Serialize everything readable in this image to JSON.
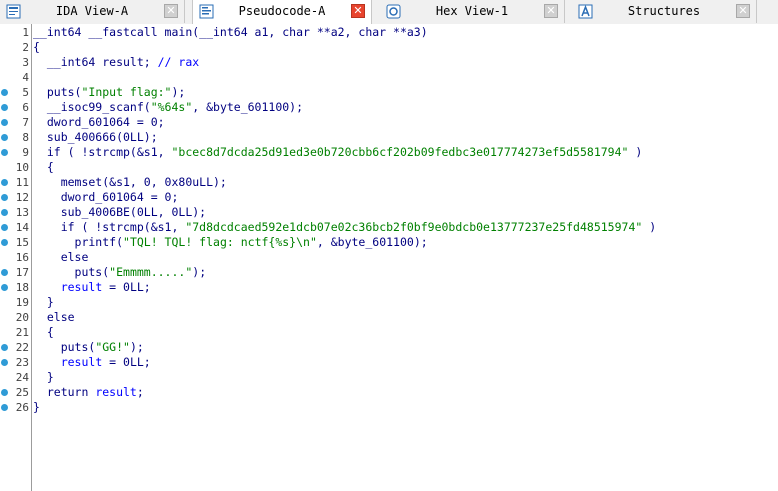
{
  "tabs": [
    {
      "label": "IDA View-A",
      "icon": "ida-view-icon",
      "active": false
    },
    {
      "label": "Pseudocode-A",
      "icon": "pseudocode-icon",
      "active": true
    },
    {
      "label": "Hex View-1",
      "icon": "hex-view-icon",
      "active": false
    },
    {
      "label": "Structures",
      "icon": "structures-icon",
      "active": false
    }
  ],
  "colors": {
    "keyword": "#000080",
    "comment": "#0000ff",
    "string": "#008000",
    "variable": "#0000ff",
    "breakpoint_dot": "#2f9bd6",
    "close_active": "#e8442e"
  },
  "code": [
    {
      "n": "1",
      "dot": false,
      "text": "__int64 __fastcall main(__int64 a1, char **a2, char **a3)",
      "tokens": [
        {
          "t": "__int64 __fastcall main(__int64 a1, char **a2, char **a3)",
          "c": "kw"
        }
      ]
    },
    {
      "n": "2",
      "dot": false,
      "text": "{",
      "tokens": [
        {
          "t": "{",
          "c": "kw"
        }
      ]
    },
    {
      "n": "3",
      "dot": false,
      "text": "  __int64 result; // rax",
      "tokens": [
        {
          "t": "  __int64 result; ",
          "c": "kw"
        },
        {
          "t": "// rax",
          "c": "cm"
        }
      ]
    },
    {
      "n": "4",
      "dot": false,
      "text": "",
      "tokens": []
    },
    {
      "n": "5",
      "dot": true,
      "text": "  puts(\"Input flag:\");",
      "tokens": [
        {
          "t": "  puts(",
          "c": "kw"
        },
        {
          "t": "\"Input flag:\"",
          "c": "str"
        },
        {
          "t": ");",
          "c": "kw"
        }
      ]
    },
    {
      "n": "6",
      "dot": true,
      "text": "  __isoc99_scanf(\"%64s\", &byte_601100);",
      "tokens": [
        {
          "t": "  __isoc99_scanf(",
          "c": "kw"
        },
        {
          "t": "\"%64s\"",
          "c": "str"
        },
        {
          "t": ", &byte_601100);",
          "c": "kw"
        }
      ]
    },
    {
      "n": "7",
      "dot": true,
      "text": "  dword_601064 = 0;",
      "tokens": [
        {
          "t": "  dword_601064 = 0;",
          "c": "kw"
        }
      ]
    },
    {
      "n": "8",
      "dot": true,
      "text": "  sub_400666(0LL);",
      "tokens": [
        {
          "t": "  sub_400666(0LL);",
          "c": "kw"
        }
      ]
    },
    {
      "n": "9",
      "dot": true,
      "text": "  if ( !strcmp(&s1, \"bcec8d7dcda25d91ed3e0b720cbb6cf202b09fedbc3e017774273ef5d5581794\") )",
      "tokens": [
        {
          "t": "  if ( !strcmp(&s1, ",
          "c": "kw"
        },
        {
          "t": "\"bcec8d7dcda25d91ed3e0b720cbb6cf202b09fedbc3e017774273ef5d5581794\"",
          "c": "str"
        },
        {
          "t": " )",
          "c": "kw"
        }
      ]
    },
    {
      "n": "10",
      "dot": false,
      "text": "  {",
      "tokens": [
        {
          "t": "  {",
          "c": "kw"
        }
      ]
    },
    {
      "n": "11",
      "dot": true,
      "text": "    memset(&s1, 0, 0x80uLL);",
      "tokens": [
        {
          "t": "    memset(&s1, 0, 0x80uLL);",
          "c": "kw"
        }
      ]
    },
    {
      "n": "12",
      "dot": true,
      "text": "    dword_601064 = 0;",
      "tokens": [
        {
          "t": "    dword_601064 = 0;",
          "c": "kw"
        }
      ]
    },
    {
      "n": "13",
      "dot": true,
      "text": "    sub_4006BE(0LL, 0LL);",
      "tokens": [
        {
          "t": "    sub_4006BE(0LL, 0LL);",
          "c": "kw"
        }
      ]
    },
    {
      "n": "14",
      "dot": true,
      "text": "    if ( !strcmp(&s1, \"7d8dcdcaed592e1dcb07e02c36bcb2f0bf9e0bdcb0e13777237e25fd48515974\") )",
      "tokens": [
        {
          "t": "    if ( !strcmp(&s1, ",
          "c": "kw"
        },
        {
          "t": "\"7d8dcdcaed592e1dcb07e02c36bcb2f0bf9e0bdcb0e13777237e25fd48515974\"",
          "c": "str"
        },
        {
          "t": " )",
          "c": "kw"
        }
      ]
    },
    {
      "n": "15",
      "dot": true,
      "text": "      printf(\"TQL! TQL! flag: nctf{%s}\\n\", &byte_601100);",
      "tokens": [
        {
          "t": "      printf(",
          "c": "kw"
        },
        {
          "t": "\"TQL! TQL! flag: nctf{%s}\\n\"",
          "c": "str"
        },
        {
          "t": ", &byte_601100);",
          "c": "kw"
        }
      ]
    },
    {
      "n": "16",
      "dot": false,
      "text": "    else",
      "tokens": [
        {
          "t": "    else",
          "c": "kw"
        }
      ]
    },
    {
      "n": "17",
      "dot": true,
      "text": "      puts(\"Emmmm.....\");",
      "tokens": [
        {
          "t": "      puts(",
          "c": "kw"
        },
        {
          "t": "\"Emmmm.....\"",
          "c": "str"
        },
        {
          "t": ");",
          "c": "kw"
        }
      ]
    },
    {
      "n": "18",
      "dot": true,
      "text": "    result = 0LL;",
      "tokens": [
        {
          "t": "    ",
          "c": "kw"
        },
        {
          "t": "result",
          "c": "var"
        },
        {
          "t": " = 0LL;",
          "c": "kw"
        }
      ]
    },
    {
      "n": "19",
      "dot": false,
      "text": "  }",
      "tokens": [
        {
          "t": "  }",
          "c": "kw"
        }
      ]
    },
    {
      "n": "20",
      "dot": false,
      "text": "  else",
      "tokens": [
        {
          "t": "  else",
          "c": "kw"
        }
      ]
    },
    {
      "n": "21",
      "dot": false,
      "text": "  {",
      "tokens": [
        {
          "t": "  {",
          "c": "kw"
        }
      ]
    },
    {
      "n": "22",
      "dot": true,
      "text": "    puts(\"GG!\");",
      "tokens": [
        {
          "t": "    puts(",
          "c": "kw"
        },
        {
          "t": "\"GG!\"",
          "c": "str"
        },
        {
          "t": ");",
          "c": "kw"
        }
      ]
    },
    {
      "n": "23",
      "dot": true,
      "text": "    result = 0LL;",
      "tokens": [
        {
          "t": "    ",
          "c": "kw"
        },
        {
          "t": "result",
          "c": "var"
        },
        {
          "t": " = 0LL;",
          "c": "kw"
        }
      ]
    },
    {
      "n": "24",
      "dot": false,
      "text": "  }",
      "tokens": [
        {
          "t": "  }",
          "c": "kw"
        }
      ]
    },
    {
      "n": "25",
      "dot": true,
      "text": "  return result;",
      "tokens": [
        {
          "t": "  return ",
          "c": "kw"
        },
        {
          "t": "result",
          "c": "var"
        },
        {
          "t": ";",
          "c": "kw"
        }
      ]
    },
    {
      "n": "26",
      "dot": true,
      "text": "}",
      "tokens": [
        {
          "t": "}",
          "c": "kw"
        }
      ]
    }
  ]
}
